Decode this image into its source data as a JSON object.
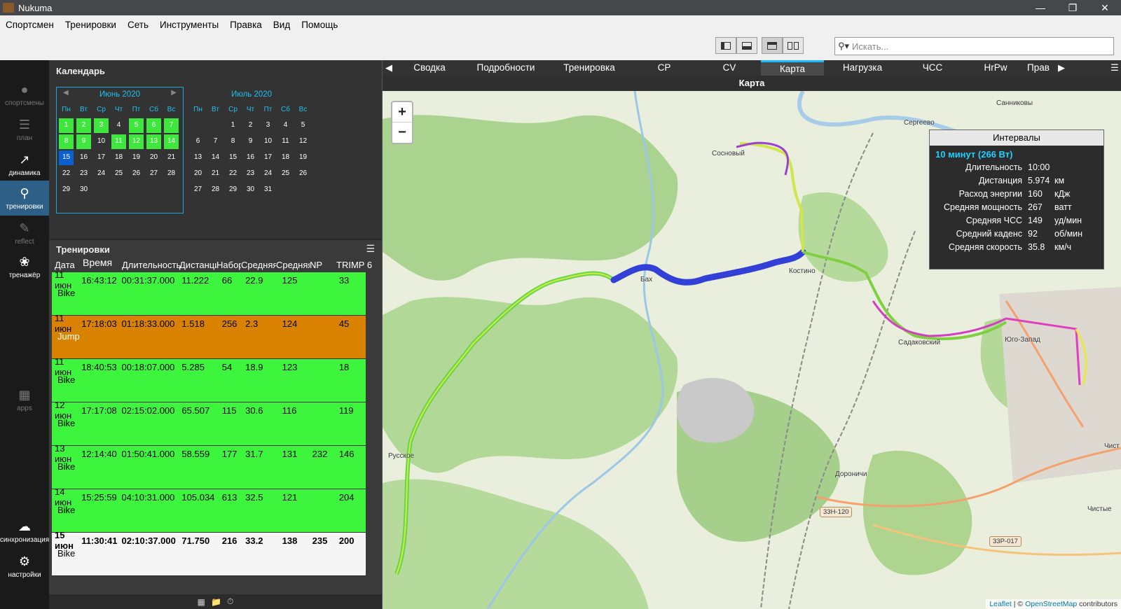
{
  "window": {
    "title": "Nukuma",
    "minimize": "—",
    "maximize": "❐",
    "close": "✕"
  },
  "menu": [
    "Спортсмен",
    "Тренировки",
    "Сеть",
    "Инструменты",
    "Правка",
    "Вид",
    "Помощь"
  ],
  "search": {
    "placeholder": "Искать..."
  },
  "sidebar": [
    {
      "label": "спортсмены",
      "icon": "athletes-icon"
    },
    {
      "label": "план",
      "icon": "plan-icon"
    },
    {
      "label": "динамика",
      "icon": "trends-icon"
    },
    {
      "label": "тренировки",
      "icon": "activities-icon"
    },
    {
      "label": "reflect",
      "icon": "reflect-icon"
    },
    {
      "label": "тренажёр",
      "icon": "trainer-icon"
    },
    {
      "label": "apps",
      "icon": "apps-icon"
    },
    {
      "label": "синхронизация",
      "icon": "sync-icon"
    },
    {
      "label": "настройки",
      "icon": "settings-icon"
    }
  ],
  "calendar": {
    "title": "Календарь",
    "weekdays": [
      "Пн",
      "Вт",
      "Ср",
      "Чт",
      "Пт",
      "Сб",
      "Вс"
    ],
    "june": {
      "title": "Июнь 2020",
      "rows": [
        [
          "1",
          "2",
          "3",
          "4",
          "5",
          "6",
          "7"
        ],
        [
          "8",
          "9",
          "10",
          "11",
          "12",
          "13",
          "14"
        ],
        [
          "15",
          "16",
          "17",
          "18",
          "19",
          "20",
          "21"
        ],
        [
          "22",
          "23",
          "24",
          "25",
          "26",
          "27",
          "28"
        ],
        [
          "29",
          "30",
          "",
          "",
          "",
          "",
          ""
        ]
      ],
      "highlighted": [
        "1",
        "2",
        "3",
        "5",
        "6",
        "7",
        "8",
        "9",
        "11",
        "12",
        "13",
        "14"
      ],
      "selected": "15"
    },
    "july": {
      "title": "Июль 2020",
      "rows": [
        [
          "",
          "",
          "1",
          "2",
          "3",
          "4",
          "5"
        ],
        [
          "6",
          "7",
          "8",
          "9",
          "10",
          "11",
          "12"
        ],
        [
          "13",
          "14",
          "15",
          "16",
          "17",
          "18",
          "19"
        ],
        [
          "20",
          "21",
          "22",
          "23",
          "24",
          "25",
          "26"
        ],
        [
          "27",
          "28",
          "29",
          "30",
          "31",
          "",
          ""
        ]
      ]
    }
  },
  "workouts": {
    "title": "Тренировки",
    "columns": [
      "Дата",
      "Время",
      "Длительность",
      "Дистанция",
      "Набор",
      "Средняя",
      "Средняя",
      "NP",
      "TRIMP 6"
    ],
    "rows": [
      {
        "date": "11 июн",
        "time": "16:43:12",
        "duration": "00:31:37.000",
        "distance": "11.222",
        "ascent": "66",
        "speed": "22.9",
        "hr": "125",
        "np": "",
        "trimp": "33",
        "sport": "Bike",
        "style": "green"
      },
      {
        "date": "11 июн",
        "time": "17:18:03",
        "duration": "01:18:33.000",
        "distance": "1.518",
        "ascent": "256",
        "speed": "2.3",
        "hr": "124",
        "np": "",
        "trimp": "45",
        "sport": "Jump",
        "style": "orange"
      },
      {
        "date": "11 июн",
        "time": "18:40:53",
        "duration": "00:18:07.000",
        "distance": "5.285",
        "ascent": "54",
        "speed": "18.9",
        "hr": "123",
        "np": "",
        "trimp": "18",
        "sport": "Bike",
        "style": "green"
      },
      {
        "date": "12 июн",
        "time": "17:17:08",
        "duration": "02:15:02.000",
        "distance": "65.507",
        "ascent": "115",
        "speed": "30.6",
        "hr": "116",
        "np": "",
        "trimp": "119",
        "sport": "Bike",
        "style": "green"
      },
      {
        "date": "13 июн",
        "time": "12:14:40",
        "duration": "01:50:41.000",
        "distance": "58.559",
        "ascent": "177",
        "speed": "31.7",
        "hr": "131",
        "np": "232",
        "trimp": "146",
        "sport": "Bike",
        "style": "green"
      },
      {
        "date": "14 июн",
        "time": "15:25:59",
        "duration": "04:10:31.000",
        "distance": "105.034",
        "ascent": "613",
        "speed": "32.5",
        "hr": "121",
        "np": "",
        "trimp": "204",
        "sport": "Bike",
        "style": "green"
      },
      {
        "date": "15 июн",
        "time": "11:30:41",
        "duration": "02:10:37.000",
        "distance": "71.750",
        "ascent": "216",
        "speed": "33.2",
        "hr": "138",
        "np": "235",
        "trimp": "200",
        "sport": "Bike",
        "style": "white"
      }
    ]
  },
  "tabs": [
    "Сводка",
    "Подробности",
    "Тренировка",
    "CP",
    "CV",
    "Карта",
    "Нагрузка",
    "ЧСС",
    "HrPw",
    "Прав"
  ],
  "active_tab": "Карта",
  "map": {
    "title": "Карта",
    "places": [
      "Санниковы",
      "Сергеево",
      "Сосновый",
      "Бах",
      "Костино",
      "Садаковский",
      "Юго-Запад",
      "Русское",
      "Дороничи",
      "Чист",
      "Чистые"
    ],
    "roads": [
      "33Н-120",
      "33Р-017"
    ],
    "attribution_leaflet": "Leaflet",
    "attribution_sep": " | © ",
    "attribution_osm": "OpenStreetMap",
    "attribution_tail": " contributors"
  },
  "intervals": {
    "title": "Интервалы",
    "name": "10 минут (266 Вт)",
    "rows": [
      {
        "label": "Длительность",
        "value": "10:00",
        "unit": ""
      },
      {
        "label": "Дистанция",
        "value": "5.974",
        "unit": "км"
      },
      {
        "label": "Расход энергии",
        "value": "160",
        "unit": "кДж"
      },
      {
        "label": "Средняя мощность",
        "value": "267",
        "unit": "ватт"
      },
      {
        "label": "Средняя ЧСС",
        "value": "149",
        "unit": "уд/мин"
      },
      {
        "label": "Средний каденс",
        "value": "92",
        "unit": "об/мин"
      },
      {
        "label": "Средняя скорость",
        "value": "35.8",
        "unit": "км/ч"
      }
    ]
  },
  "colors": {
    "accent": "#20b8ff",
    "green_row": "#3ef53e",
    "orange_row": "#d88200",
    "route_highlight": "#3340d8"
  }
}
